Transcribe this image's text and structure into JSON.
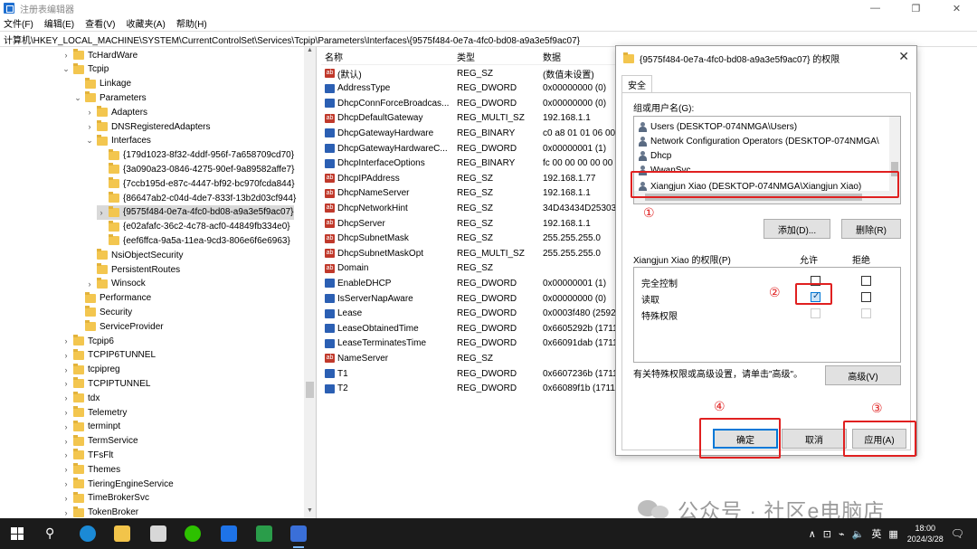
{
  "window": {
    "title": "注册表编辑器",
    "controls": [
      "—",
      "❐",
      "✕"
    ]
  },
  "menu": [
    "文件(F)",
    "编辑(E)",
    "查看(V)",
    "收藏夹(A)",
    "帮助(H)"
  ],
  "address": "计算机\\HKEY_LOCAL_MACHINE\\SYSTEM\\CurrentControlSet\\Services\\Tcpip\\Parameters\\Interfaces\\{9575f484-0e7a-4fc0-bd08-a9a3e5f9ac07}",
  "tree": [
    {
      "label": "TcHardWare",
      "expand": ">"
    },
    {
      "label": "Tcpip",
      "expand": "v"
    },
    {
      "label": "Linkage",
      "expand": ""
    },
    {
      "label": "Parameters",
      "expand": "v"
    },
    {
      "label": "Adapters",
      "expand": ">"
    },
    {
      "label": "DNSRegisteredAdapters",
      "expand": ">"
    },
    {
      "label": "Interfaces",
      "expand": "v"
    },
    {
      "label": "{179d1023-8f32-4ddf-956f-7a658709cd70}",
      "expand": ""
    },
    {
      "label": "{3a090a23-0846-4275-90ef-9a89582affe7}",
      "expand": ""
    },
    {
      "label": "{7ccb195d-e87c-4447-bf92-bc970fcda844}",
      "expand": ""
    },
    {
      "label": "{86647ab2-c04d-4de7-833f-13b2d03cf944}",
      "expand": ""
    },
    {
      "label": "{9575f484-0e7a-4fc0-bd08-a9a3e5f9ac07}",
      "expand": ">",
      "selected": true
    },
    {
      "label": "{e02afafc-36c2-4c78-acf0-44849fb334e0}",
      "expand": ""
    },
    {
      "label": "{eef6ffca-9a5a-11ea-9cd3-806e6f6e6963}",
      "expand": ""
    },
    {
      "label": "NsiObjectSecurity",
      "expand": ""
    },
    {
      "label": "PersistentRoutes",
      "expand": ""
    },
    {
      "label": "Winsock",
      "expand": ">"
    },
    {
      "label": "Performance",
      "expand": ""
    },
    {
      "label": "Security",
      "expand": ""
    },
    {
      "label": "ServiceProvider",
      "expand": ""
    },
    {
      "label": "Tcpip6",
      "expand": ">"
    },
    {
      "label": "TCPIP6TUNNEL",
      "expand": ">"
    },
    {
      "label": "tcpipreg",
      "expand": ">"
    },
    {
      "label": "TCPIPTUNNEL",
      "expand": ">"
    },
    {
      "label": "tdx",
      "expand": ">"
    },
    {
      "label": "Telemetry",
      "expand": ">"
    },
    {
      "label": "terminpt",
      "expand": ">"
    },
    {
      "label": "TermService",
      "expand": ">"
    },
    {
      "label": "TFsFlt",
      "expand": ">"
    },
    {
      "label": "Themes",
      "expand": ">"
    },
    {
      "label": "TieringEngineService",
      "expand": ">"
    },
    {
      "label": "TimeBrokerSvc",
      "expand": ">"
    },
    {
      "label": "TokenBroker",
      "expand": ">"
    }
  ],
  "list": {
    "headers": {
      "name": "名称",
      "type": "类型",
      "data": "数据"
    },
    "rows": [
      {
        "name": "(默认)",
        "type": "REG_SZ",
        "data": "(数值未设置)",
        "icon": "ab"
      },
      {
        "name": "AddressType",
        "type": "REG_DWORD",
        "data": "0x00000000 (0)",
        "icon": "bin"
      },
      {
        "name": "DhcpConnForceBroadcas...",
        "type": "REG_DWORD",
        "data": "0x00000000 (0)",
        "icon": "bin"
      },
      {
        "name": "DhcpDefaultGateway",
        "type": "REG_MULTI_SZ",
        "data": "192.168.1.1",
        "icon": "ab"
      },
      {
        "name": "DhcpGatewayHardware",
        "type": "REG_BINARY",
        "data": "c0 a8 01 01 06 00",
        "icon": "bin"
      },
      {
        "name": "DhcpGatewayHardwareC...",
        "type": "REG_DWORD",
        "data": "0x00000001 (1)",
        "icon": "bin"
      },
      {
        "name": "DhcpInterfaceOptions",
        "type": "REG_BINARY",
        "data": "fc 00 00 00 00 00",
        "icon": "bin"
      },
      {
        "name": "DhcpIPAddress",
        "type": "REG_SZ",
        "data": "192.168.1.77",
        "icon": "ab"
      },
      {
        "name": "DhcpNameServer",
        "type": "REG_SZ",
        "data": "192.168.1.1",
        "icon": "ab"
      },
      {
        "name": "DhcpNetworkHint",
        "type": "REG_SZ",
        "data": "34D43434D25303",
        "icon": "ab"
      },
      {
        "name": "DhcpServer",
        "type": "REG_SZ",
        "data": "192.168.1.1",
        "icon": "ab"
      },
      {
        "name": "DhcpSubnetMask",
        "type": "REG_SZ",
        "data": "255.255.255.0",
        "icon": "ab"
      },
      {
        "name": "DhcpSubnetMaskOpt",
        "type": "REG_MULTI_SZ",
        "data": "255.255.255.0",
        "icon": "ab"
      },
      {
        "name": "Domain",
        "type": "REG_SZ",
        "data": "",
        "icon": "ab"
      },
      {
        "name": "EnableDHCP",
        "type": "REG_DWORD",
        "data": "0x00000001 (1)",
        "icon": "bin"
      },
      {
        "name": "IsServerNapAware",
        "type": "REG_DWORD",
        "data": "0x00000000 (0)",
        "icon": "bin"
      },
      {
        "name": "Lease",
        "type": "REG_DWORD",
        "data": "0x0003f480 (2592",
        "icon": "bin"
      },
      {
        "name": "LeaseObtainedTime",
        "type": "REG_DWORD",
        "data": "0x6605292b (1711",
        "icon": "bin"
      },
      {
        "name": "LeaseTerminatesTime",
        "type": "REG_DWORD",
        "data": "0x66091dab (1711",
        "icon": "bin"
      },
      {
        "name": "NameServer",
        "type": "REG_SZ",
        "data": "",
        "icon": "ab"
      },
      {
        "name": "T1",
        "type": "REG_DWORD",
        "data": "0x6607236b (1711",
        "icon": "bin"
      },
      {
        "name": "T2",
        "type": "REG_DWORD",
        "data": "0x66089f1b (1711",
        "icon": "bin"
      }
    ]
  },
  "dialog": {
    "title": "{9575f484-0e7a-4fc0-bd08-a9a3e5f9ac07} 的权限",
    "tab": "安全",
    "group_label": "组或用户名(G):",
    "users": [
      "Users (DESKTOP-074NMGA\\Users)",
      "Network Configuration Operators (DESKTOP-074NMGA\\",
      "Dhcp",
      "WwanSvc",
      "Xiangjun Xiao (DESKTOP-074NMGA\\Xiangjun Xiao)"
    ],
    "add_button": "添加(D)...",
    "remove_button": "删除(R)",
    "perm_label": "Xiangjun Xiao 的权限(P)",
    "allow_label": "允许",
    "deny_label": "拒绝",
    "permissions": [
      {
        "name": "完全控制",
        "allow": false,
        "deny": false,
        "disabled": false
      },
      {
        "name": "读取",
        "allow": true,
        "deny": false,
        "disabled": false
      },
      {
        "name": "特殊权限",
        "allow": false,
        "deny": false,
        "disabled": true
      }
    ],
    "advanced_hint": "有关特殊权限或高级设置，请单击\"高级\"。",
    "advanced_button": "高级(V)",
    "ok_button": "确定",
    "cancel_button": "取消",
    "apply_button": "应用(A)"
  },
  "annotations": [
    "①",
    "②",
    "③",
    "④"
  ],
  "taskbar": {
    "tray_symbols": [
      "∧",
      "⊡",
      "⌁",
      "🔈",
      "英",
      "▦"
    ],
    "time": "18:00",
    "date": "2024/3/28",
    "notification": "🗨"
  },
  "watermark": "公众号 · 社区e电脑店"
}
